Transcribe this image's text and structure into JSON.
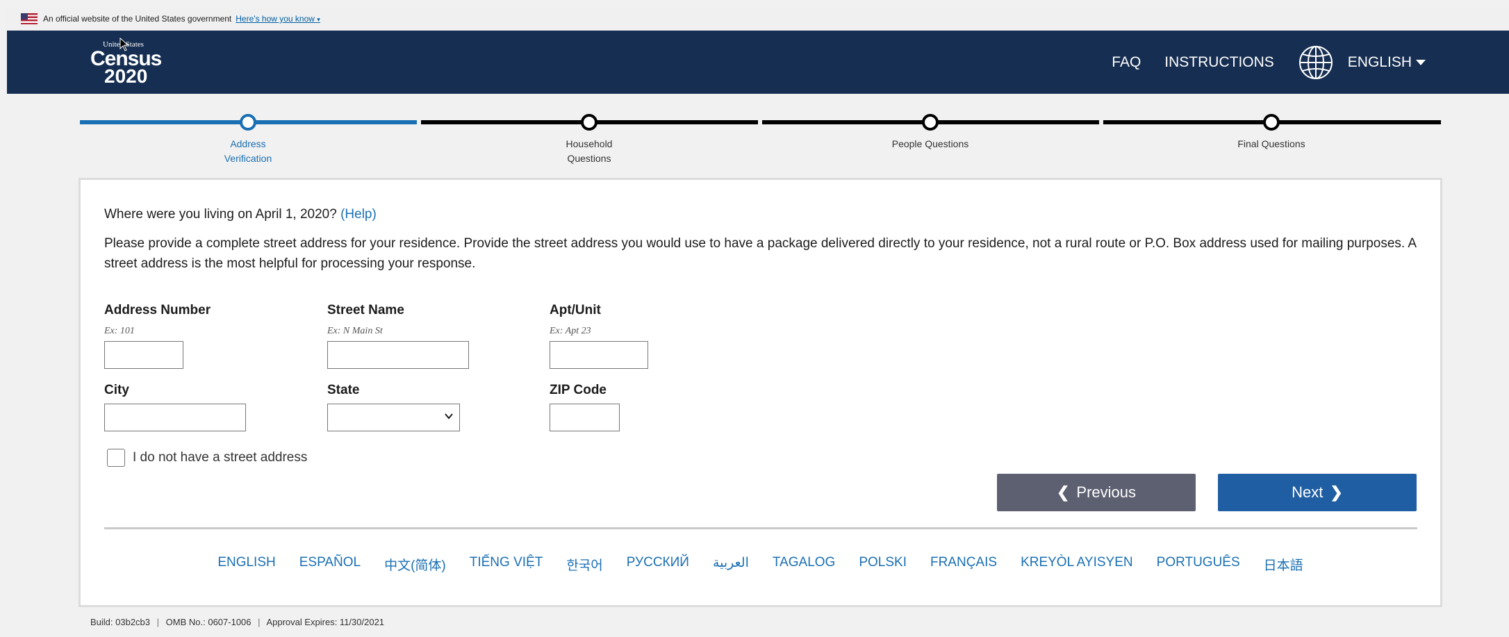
{
  "gov_banner": {
    "text": "An official website of the United States government",
    "link": "Here's how you know",
    "link_caret": "▾"
  },
  "header": {
    "logo": {
      "small": "United States",
      "census": "Census",
      "year": "2020"
    },
    "nav": {
      "faq": "FAQ",
      "instructions": "INSTRUCTIONS",
      "language": "ENGLISH"
    },
    "icons": {
      "globe": "globe-icon",
      "language_caret": "caret-down-icon"
    },
    "colors": {
      "background": "#162e51",
      "text": "#ffffff"
    }
  },
  "progress": {
    "steps": [
      {
        "label_line1": "Address",
        "label_line2": "Verification",
        "active": true
      },
      {
        "label_line1": "Household",
        "label_line2": "Questions",
        "active": false
      },
      {
        "label_line1": "People Questions",
        "label_line2": "",
        "active": false
      },
      {
        "label_line1": "Final Questions",
        "label_line2": "",
        "active": false
      }
    ],
    "colors": {
      "active": "#1a6fb3",
      "inactive": "#000000"
    }
  },
  "form": {
    "question": "Where were you living on April 1, 2020?",
    "help_link": "(Help)",
    "description": "Please provide a complete street address for your residence. Provide the street address you would use to have a package delivered directly to your residence, not a rural route or P.O. Box address used for mailing purposes. A street address is the most helpful for processing your response.",
    "fields": {
      "address_number": {
        "label": "Address Number",
        "hint": "Ex: 101",
        "value": ""
      },
      "street_name": {
        "label": "Street Name",
        "hint": "Ex: N Main St",
        "value": ""
      },
      "apt_unit": {
        "label": "Apt/Unit",
        "hint": "Ex: Apt 23",
        "value": ""
      },
      "city": {
        "label": "City",
        "value": ""
      },
      "state": {
        "label": "State",
        "value": ""
      },
      "zip": {
        "label": "ZIP Code",
        "value": ""
      }
    },
    "no_street_address": {
      "label": "I do not have a street address",
      "checked": false
    },
    "buttons": {
      "previous": "Previous",
      "next": "Next",
      "previous_arrow": "❮",
      "next_arrow": "❯"
    },
    "colors": {
      "previous": "#5c6070",
      "next": "#1f5ea2",
      "link": "#1a6fb3"
    }
  },
  "languages": [
    "ENGLISH",
    "ESPAÑOL",
    "中文(简体)",
    "TIẾNG VIỆT",
    "한국어",
    "РУССКИЙ",
    "العربية",
    "TAGALOG",
    "POLSKI",
    "FRANÇAIS",
    "KREYÒL AYISYEN",
    "PORTUGUÊS",
    "日本語"
  ],
  "footer": {
    "build": "Build: 03b2cb3",
    "omb": "OMB No.: 0607-1006",
    "approval": "Approval Expires: 11/30/2021",
    "separator": "|"
  }
}
